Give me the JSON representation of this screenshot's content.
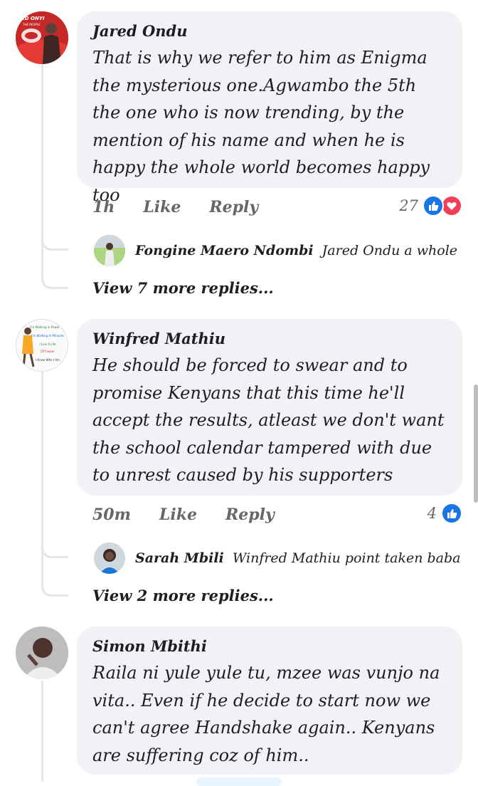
{
  "comments": [
    {
      "author": "Jared Ondu",
      "text": "That is why we refer to him as Enigma the mysterious one.Agwambo the 5th the one who is now trending, by the mention of his name and when he is happy the whole world becomes happy too",
      "time": "1h",
      "like_label": "Like",
      "reply_label": "Reply",
      "reaction_count": "27",
      "reactions": [
        "like-icon",
        "love-icon"
      ],
      "reply_preview": {
        "author": "Fongine Maero Ndombi",
        "text": "Jared Ondu a whole morn..."
      },
      "view_more": "View 7 more replies..."
    },
    {
      "author": "Winfred Mathiu",
      "text": "He should be forced to swear and to promise Kenyans that this time he'll accept the results, atleast we don't want the school calendar tampered with due to unrest caused by his supporters",
      "time": "50m",
      "like_label": "Like",
      "reply_label": "Reply",
      "reaction_count": "4",
      "reactions": [
        "like-icon"
      ],
      "reply_preview": {
        "author": "Sarah Mbili",
        "text": "Winfred Mathiu point taken baba shoul..."
      },
      "view_more": "View 2 more replies..."
    },
    {
      "author": "Simon Mbithi",
      "text": "Raila ni yule yule tu, mzee was vunjo na vita.. Even if he decide to start now we can't agree Handshake again.. Kenyans are suffering coz of him.."
    }
  ],
  "avatar1_text": [
    "ED ONYI",
    "THE PEOPLE"
  ],
  "avatar2_text": [
    "I'm Walking in Power",
    "I'm Walking In Miracles",
    "I Live A Life",
    "Of Favour",
    "I Know Who I Am"
  ],
  "colors": {
    "bubble": "#f0f2f5",
    "meta": "#65676b",
    "like": "#1b74e4",
    "love": "#f33e58",
    "thread": "#e4e6eb"
  }
}
